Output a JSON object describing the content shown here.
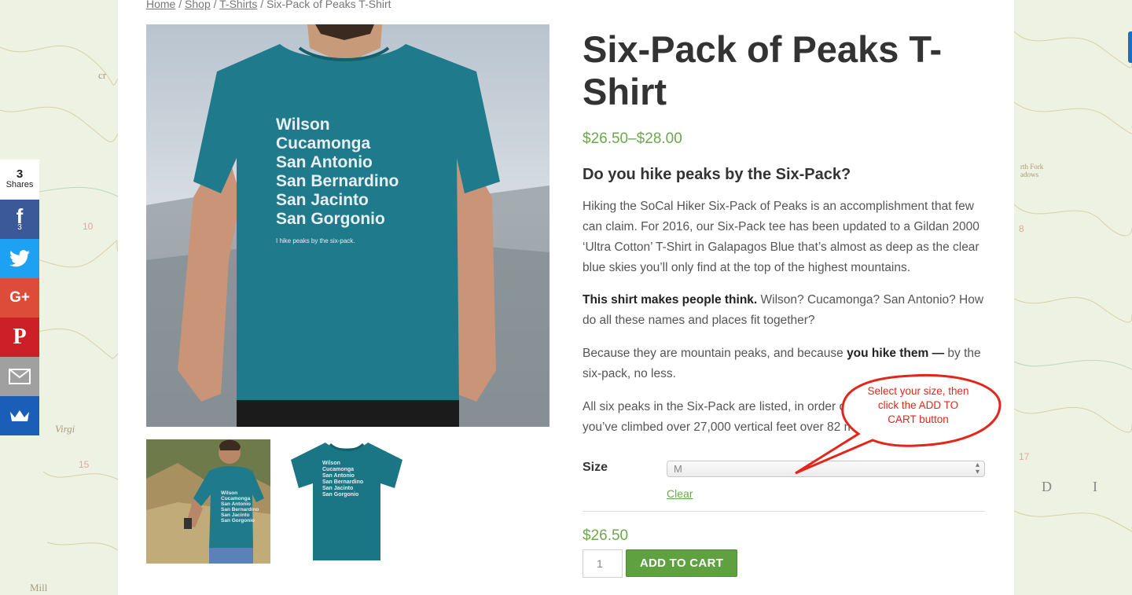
{
  "breadcrumb": {
    "home": "Home",
    "sep1": " / ",
    "shop": "Shop",
    "sep2": " / ",
    "tshirts": "T-Shirts",
    "sep3": " / ",
    "current": "Six-Pack of Peaks T-Shirt"
  },
  "shirt_print": {
    "peaks": [
      "Wilson",
      "Cucamonga",
      "San Antonio",
      "San Bernardino",
      "San Jacinto",
      "San Gorgonio"
    ],
    "tagline": "I hike peaks by the six-pack."
  },
  "product": {
    "title": "Six-Pack of Peaks T-Shirt",
    "price_range": "$26.50–$28.00",
    "desc_heading": "Do you hike peaks by the Six-Pack?",
    "p1": "Hiking the SoCal Hiker Six-Pack of Peaks is an accomplishment that few can claim. For 2016, our Six-Pack tee has been updated to a Gildan 2000 ‘Ultra Cotton’ T-Shirt in Galapagos Blue that’s almost as deep as the clear blue skies you’ll only find at the top of the highest mountains.",
    "p2_bold": "This shirt makes people think.",
    "p2_rest": " Wilson? Cucamonga? San Antonio? How do all these names and places fit together?",
    "p3_start": "Because they are mountain peaks, and because ",
    "p3_bold": "you hike them —",
    "p3_end": " by the six-pack, no less.",
    "p4": "All six peaks in the Six-Pack are listed, in order of you’ve climbed over 27,000 vertical feet over 82 mi"
  },
  "variation": {
    "size_label": "Size",
    "size_value": "M",
    "clear_label": "Clear",
    "price": "$26.50"
  },
  "cart": {
    "quantity": "1",
    "add_label": "ADD TO CART"
  },
  "callout": {
    "text": "Select your size, then click the ADD TO CART button"
  },
  "share": {
    "total": "3",
    "total_label": "Shares",
    "facebook_count": "3",
    "icons": [
      "facebook-icon",
      "twitter-icon",
      "google-plus-icon",
      "pinterest-icon",
      "email-icon",
      "sumome-crown-icon"
    ]
  },
  "colors": {
    "accent_green": "#6aa84f",
    "button_green": "#5fa040",
    "callout_red": "#e3261b",
    "shirt_teal": "#1f7a8c"
  }
}
